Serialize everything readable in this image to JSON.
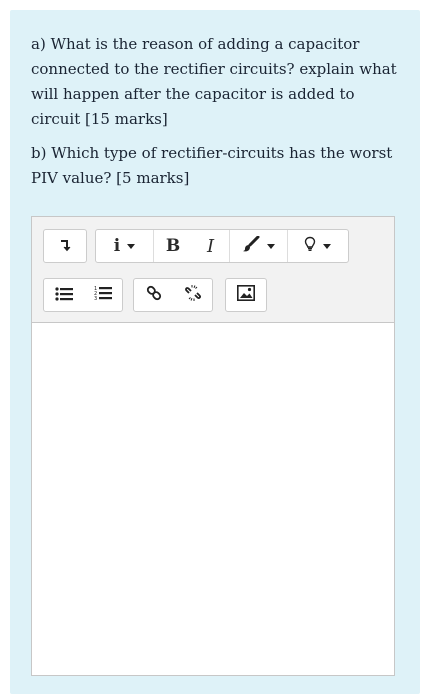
{
  "question": {
    "part_a": "a) What is the reason of adding a capacitor connected to the rectifier circuits? explain what will happen after the capacitor is added to circuit [15 marks]",
    "part_b": "b)  Which type of rectifier-circuits has the worst PIV value? [5 marks]"
  },
  "editor": {
    "toolbar": {
      "row1": [
        {
          "name": "toggle-toolbar-icon"
        },
        {
          "name": "paragraph-styles-icon",
          "label": "i",
          "dropdown": true
        },
        {
          "name": "bold-icon",
          "label": "B"
        },
        {
          "name": "italic-icon",
          "label": "I"
        },
        {
          "name": "font-color-icon",
          "dropdown": true
        },
        {
          "name": "insert-equation-icon",
          "dropdown": true
        }
      ],
      "row2": [
        {
          "name": "unordered-list-icon"
        },
        {
          "name": "ordered-list-icon"
        },
        {
          "name": "link-icon"
        },
        {
          "name": "unlink-icon"
        },
        {
          "name": "insert-image-icon"
        }
      ]
    },
    "content": ""
  }
}
